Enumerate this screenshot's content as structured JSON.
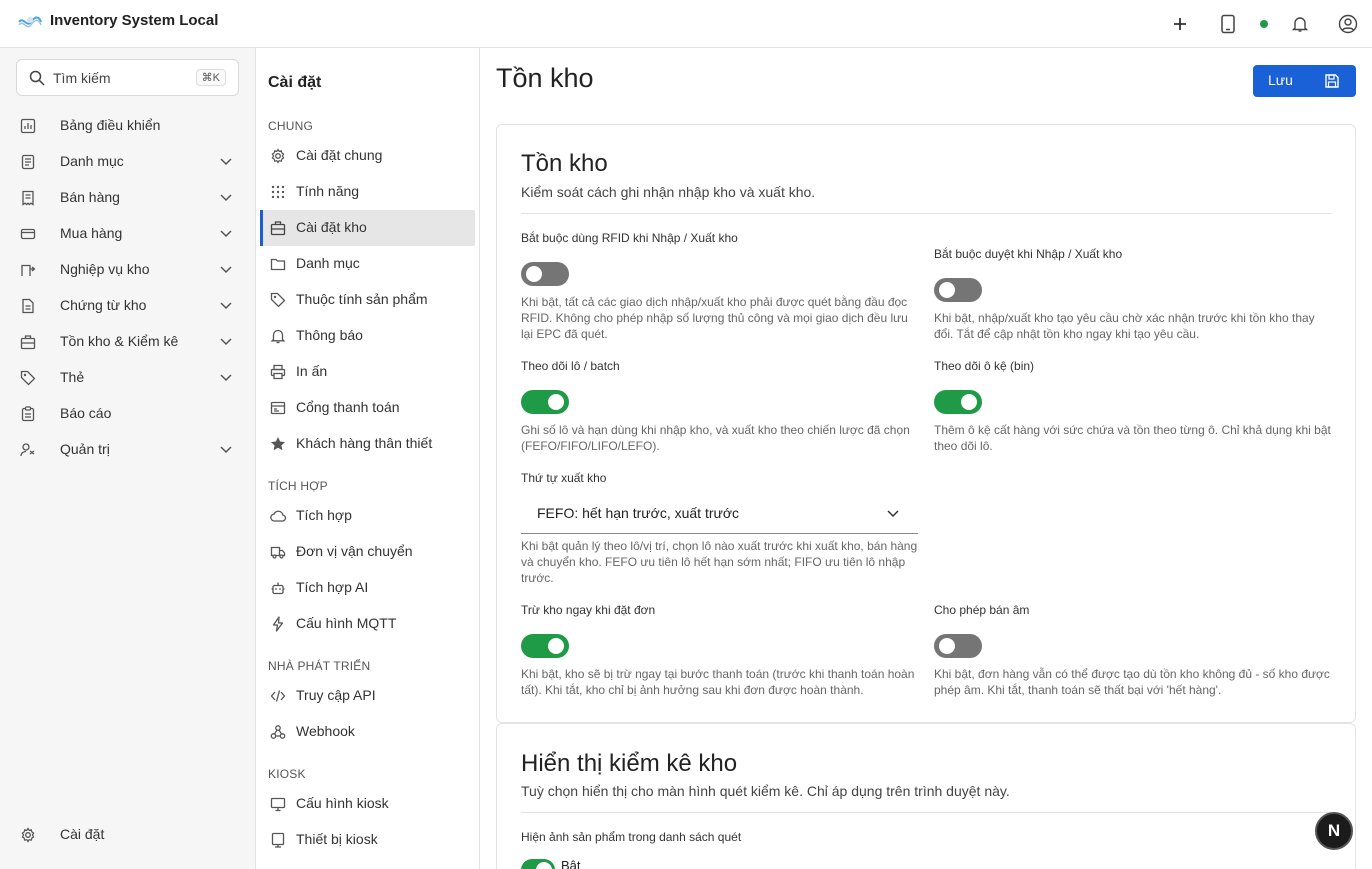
{
  "app": {
    "title": "Inventory System Local"
  },
  "search": {
    "placeholder": "Tìm kiếm",
    "shortcut": "⌘K"
  },
  "sidebar": {
    "items": [
      {
        "label": "Bảng điều khiển",
        "icon": "dashboard-icon",
        "expandable": false
      },
      {
        "label": "Danh mục",
        "icon": "catalog-icon",
        "expandable": true
      },
      {
        "label": "Bán hàng",
        "icon": "receipt-icon",
        "expandable": true
      },
      {
        "label": "Mua hàng",
        "icon": "card-icon",
        "expandable": true
      },
      {
        "label": "Nghiệp vụ kho",
        "icon": "warehouse-ops-icon",
        "expandable": true
      },
      {
        "label": "Chứng từ kho",
        "icon": "document-icon",
        "expandable": true
      },
      {
        "label": "Tồn kho & Kiểm kê",
        "icon": "inventory-icon",
        "expandable": true
      },
      {
        "label": "Thẻ",
        "icon": "tag-icon",
        "expandable": true
      },
      {
        "label": "Báo cáo",
        "icon": "report-icon",
        "expandable": false
      },
      {
        "label": "Quản trị",
        "icon": "admin-icon",
        "expandable": true
      }
    ],
    "footer_label": "Cài đặt"
  },
  "settings_nav": {
    "title": "Cài đặt",
    "sections": [
      {
        "title": "CHUNG",
        "items": [
          {
            "label": "Cài đặt chung",
            "icon": "gear-icon"
          },
          {
            "label": "Tính năng",
            "icon": "grid-dots-icon"
          },
          {
            "label": "Cài đặt kho",
            "icon": "warehouse-icon",
            "active": true
          },
          {
            "label": "Danh mục",
            "icon": "folder-icon"
          },
          {
            "label": "Thuộc tính sản phẩm",
            "icon": "tag-icon"
          },
          {
            "label": "Thông báo",
            "icon": "bell-icon"
          },
          {
            "label": "In ấn",
            "icon": "printer-icon"
          },
          {
            "label": "Cổng thanh toán",
            "icon": "payment-icon"
          },
          {
            "label": "Khách hàng thân thiết",
            "icon": "star-icon"
          }
        ]
      },
      {
        "title": "TÍCH HỢP",
        "items": [
          {
            "label": "Tích hợp",
            "icon": "cloud-icon"
          },
          {
            "label": "Đơn vị vận chuyển",
            "icon": "truck-icon"
          },
          {
            "label": "Tích hợp AI",
            "icon": "robot-icon"
          },
          {
            "label": "Cấu hình MQTT",
            "icon": "lightning-icon"
          }
        ]
      },
      {
        "title": "NHÀ PHÁT TRIỂN",
        "items": [
          {
            "label": "Truy cập API",
            "icon": "code-icon"
          },
          {
            "label": "Webhook",
            "icon": "webhook-icon"
          }
        ]
      },
      {
        "title": "KIOSK",
        "items": [
          {
            "label": "Cấu hình kiosk",
            "icon": "monitor-icon"
          },
          {
            "label": "Thiết bị kiosk",
            "icon": "device-icon"
          }
        ]
      }
    ]
  },
  "page": {
    "title": "Tồn kho",
    "save_label": "Lưu"
  },
  "inventory_card": {
    "title": "Tồn kho",
    "subtitle": "Kiểm soát cách ghi nhận nhập kho và xuất kho.",
    "fields": [
      {
        "label": "Bắt buộc dùng RFID khi Nhập / Xuất kho",
        "on": false,
        "help": "Khi bật, tất cả các giao dịch nhập/xuất kho phải được quét bằng đầu đọc RFID. Không cho phép nhập số lượng thủ công và mọi giao dịch đều lưu lại EPC đã quét."
      },
      {
        "label": "Bắt buộc duyệt khi Nhập / Xuất kho",
        "on": false,
        "help": "Khi bật, nhập/xuất kho tạo yêu cầu chờ xác nhận trước khi tồn kho thay đổi. Tắt để cập nhật tồn kho ngay khi tạo yêu cầu."
      },
      {
        "label": "Theo dõi lô / batch",
        "on": true,
        "help": "Ghi số lô và hạn dùng khi nhập kho, và xuất kho theo chiến lược đã chọn (FEFO/FIFO/LIFO/LEFO)."
      },
      {
        "label": "Theo dõi ô kệ (bin)",
        "on": true,
        "help": "Thêm ô kệ cất hàng với sức chứa và tồn theo từng ô. Chỉ khả dụng khi bật theo dõi lô."
      },
      {
        "label": "Trừ kho ngay khi đặt đơn",
        "on": true,
        "help": "Khi bật, kho sẽ bị trừ ngay tại bước thanh toán (trước khi thanh toán hoàn tất). Khi tắt, kho chỉ bị ảnh hưởng sau khi đơn được hoàn thành."
      },
      {
        "label": "Cho phép bán âm",
        "on": false,
        "help": "Khi bật, đơn hàng vẫn có thể được tạo dù tồn kho không đủ - số kho được phép âm. Khi tắt, thanh toán sẽ thất bại với 'hết hàng'."
      }
    ],
    "issue_order": {
      "label": "Thứ tự xuất kho",
      "value": "FEFO: hết hạn trước, xuất trước",
      "help": "Khi bật quản lý theo lô/vị trí, chọn lô nào xuất trước khi xuất kho, bán hàng và chuyển kho. FEFO ưu tiên lô hết hạn sớm nhất; FIFO ưu tiên lô nhập trước."
    }
  },
  "count_card": {
    "title": "Hiển thị kiểm kê kho",
    "subtitle": "Tuỳ chọn hiển thị cho màn hình quét kiểm kê. Chỉ áp dụng trên trình duyệt này.",
    "field_label": "Hiện ảnh sản phẩm trong danh sách quét",
    "toggle_on": true,
    "toggle_text": "Bật"
  },
  "fab": {
    "label": "N"
  },
  "colors": {
    "accent": "#1a60d6",
    "toggle_on": "#1f9a47",
    "toggle_off": "#757575",
    "active_bar": "#1b5fc7"
  }
}
